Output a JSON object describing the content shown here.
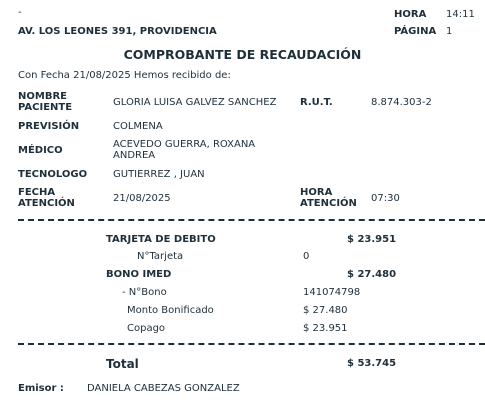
{
  "header": {
    "dash_mark": "-",
    "address": "AV. LOS LEONES 391, PROVIDENCIA",
    "hora_label": "HORA",
    "hora_value": "14:11",
    "pagina_label": "PÁGINA",
    "pagina_value": "1"
  },
  "title": "COMPROBANTE DE RECAUDACIÓN",
  "intro": "Con Fecha 21/08/2025 Hemos recibido de:",
  "patient": {
    "nombre_label_1": "NOMBRE",
    "nombre_label_2": "PACIENTE",
    "nombre_value": "GLORIA LUISA GALVEZ SANCHEZ",
    "rut_label": "R.U.T.",
    "rut_value": "8.874.303-2",
    "prevision_label": "PREVISIÓN",
    "prevision_value": "COLMENA",
    "medico_label": "MÉDICO",
    "medico_value_1": "ACEVEDO GUERRA, ROXANA",
    "medico_value_2": "ANDREA",
    "tecnologo_label": "TECNOLOGO",
    "tecnologo_value": "GUTIERREZ , JUAN",
    "fecha_label_1": "FECHA",
    "fecha_label_2": "ATENCIÓN",
    "fecha_value": "21/08/2025",
    "hora_label_1": "HORA",
    "hora_label_2": "ATENCIÓN",
    "hora_value": "07:30"
  },
  "payments": {
    "tarjeta_label": "TARJETA DE DEBITO",
    "tarjeta_amount": "$ 23.951",
    "ntarjeta_label": "N°Tarjeta",
    "ntarjeta_value": "0",
    "bono_label": "BONO IMED",
    "bono_amount": "$ 27.480",
    "nbono_label": "- N°Bono",
    "nbono_value": "141074798",
    "monto_label": "Monto Bonificado",
    "monto_value": "$ 27.480",
    "copago_label": "Copago",
    "copago_value": "$ 23.951"
  },
  "total": {
    "label": "Total",
    "value": "$ 53.745"
  },
  "emisor": {
    "label": "Emisor :",
    "value": "DANIELA CABEZAS GONZALEZ"
  }
}
